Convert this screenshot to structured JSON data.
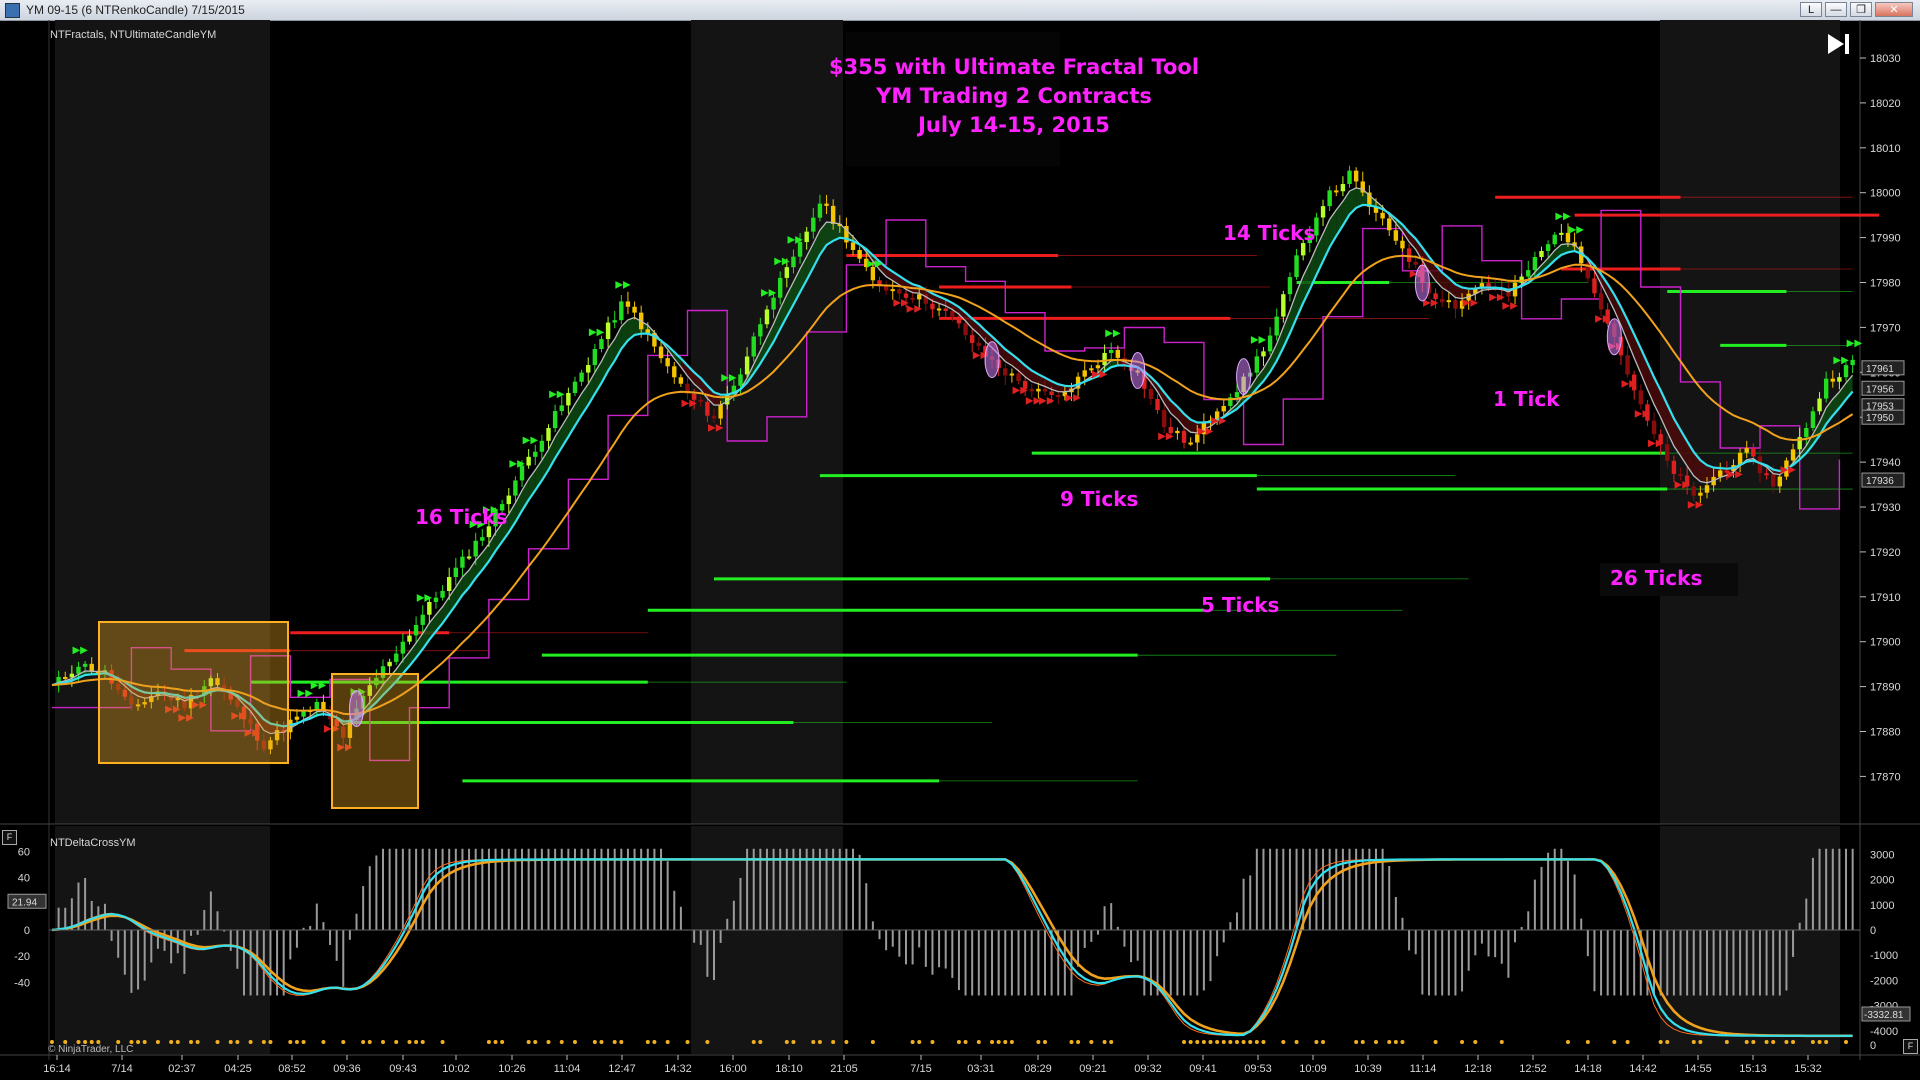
{
  "window": {
    "title": "YM 09-15 (6 NTRenkoCandle)  7/15/2015",
    "buttons": [
      "L",
      "—",
      "❐",
      "✕"
    ]
  },
  "colors": {
    "background": "#000000",
    "session_shade": "#141414",
    "up_bar": "#22dd22",
    "up_bar_light": "#b8ff2a",
    "down_bar": "#e02020",
    "down_bar_dark": "#8a0c0c",
    "neutral_bar": "#f5c400",
    "fast_ma": "#35e0ee",
    "slow_ma": "#f0a21d",
    "channel_line": "#bbbbbb",
    "support_line": "#22ee22",
    "resistance_line": "#ee1e1e",
    "fractal_line": "#cc22cc",
    "annotation": "#ff22ff",
    "highlight_box": "#e8a020"
  },
  "main_panel": {
    "indicator_label": "NTFractals, NTUltimateCandleYM",
    "headline": [
      "$355 with Ultimate Fractal Tool",
      "YM Trading 2 Contracts",
      "July 14-15, 2015"
    ],
    "annotations": [
      "16 Ticks",
      "14 Ticks",
      "9 Ticks",
      "5 Ticks",
      "1 Tick",
      "26 Ticks"
    ],
    "price_axis": [
      "18030",
      "18020",
      "18010",
      "18000",
      "17990",
      "17980",
      "17970",
      "17960",
      "17950",
      "17940",
      "17930",
      "17920",
      "17910",
      "17900",
      "17890",
      "17880",
      "17870"
    ],
    "price_markers": [
      "17961",
      "17956",
      "17953",
      "17950",
      "17936"
    ],
    "play_icon": "skip-to-end-icon"
  },
  "sub_panel": {
    "indicator_label": "NTDeltaCrossYM",
    "left_axis": [
      "60",
      "40",
      "20",
      "0",
      "-20",
      "-40"
    ],
    "left_marker": "21.94",
    "right_axis": [
      "3000",
      "2000",
      "1000",
      "0",
      "-1000",
      "-2000",
      "-3000",
      "-4000"
    ],
    "right_marker": "-3332.81",
    "panel_button": "F",
    "copyright": "© NinjaTrader, LLC",
    "zero_label": "0",
    "f_button": "F"
  },
  "time_axis": [
    "16:14",
    "7/14",
    "02:37",
    "04:25",
    "08:52",
    "09:36",
    "09:43",
    "10:02",
    "10:26",
    "11:04",
    "12:47",
    "14:32",
    "16:00",
    "18:10",
    "21:05",
    "7/15",
    "03:31",
    "08:29",
    "09:21",
    "09:32",
    "09:41",
    "09:53",
    "10:09",
    "10:39",
    "11:14",
    "12:18",
    "12:52",
    "14:18",
    "14:42",
    "14:55",
    "15:13",
    "15:32"
  ],
  "chart_data": {
    "type": "candlestick",
    "instrument": "YM 09-15",
    "bar_type": "6 NTRenkoCandle",
    "price_range": [
      17862,
      18035
    ],
    "price_path": [
      [
        0,
        17890
      ],
      [
        4,
        17895
      ],
      [
        8,
        17893
      ],
      [
        12,
        17885
      ],
      [
        16,
        17889
      ],
      [
        20,
        17886
      ],
      [
        24,
        17892
      ],
      [
        28,
        17885
      ],
      [
        32,
        17877
      ],
      [
        36,
        17882
      ],
      [
        40,
        17886
      ],
      [
        44,
        17879
      ],
      [
        48,
        17890
      ],
      [
        54,
        17902
      ],
      [
        60,
        17914
      ],
      [
        66,
        17926
      ],
      [
        72,
        17941
      ],
      [
        78,
        17955
      ],
      [
        82,
        17965
      ],
      [
        86,
        17975
      ],
      [
        88,
        17973
      ],
      [
        92,
        17963
      ],
      [
        96,
        17955
      ],
      [
        100,
        17950
      ],
      [
        104,
        17960
      ],
      [
        108,
        17975
      ],
      [
        112,
        17985
      ],
      [
        116,
        17998
      ],
      [
        120,
        17990
      ],
      [
        124,
        17980
      ],
      [
        128,
        17978
      ],
      [
        132,
        17976
      ],
      [
        136,
        17972
      ],
      [
        140,
        17965
      ],
      [
        144,
        17960
      ],
      [
        148,
        17956
      ],
      [
        152,
        17954
      ],
      [
        156,
        17960
      ],
      [
        160,
        17965
      ],
      [
        164,
        17960
      ],
      [
        168,
        17948
      ],
      [
        172,
        17944
      ],
      [
        176,
        17952
      ],
      [
        180,
        17958
      ],
      [
        184,
        17968
      ],
      [
        188,
        17985
      ],
      [
        192,
        17998
      ],
      [
        196,
        18004
      ],
      [
        200,
        17995
      ],
      [
        204,
        17988
      ],
      [
        208,
        17978
      ],
      [
        212,
        17975
      ],
      [
        216,
        17980
      ],
      [
        220,
        17977
      ],
      [
        224,
        17985
      ],
      [
        228,
        17992
      ],
      [
        232,
        17982
      ],
      [
        236,
        17968
      ],
      [
        240,
        17952
      ],
      [
        244,
        17940
      ],
      [
        248,
        17932
      ],
      [
        252,
        17938
      ],
      [
        256,
        17942
      ],
      [
        260,
        17935
      ],
      [
        264,
        17945
      ],
      [
        268,
        17958
      ],
      [
        272,
        17962
      ]
    ],
    "sub_panel": {
      "left_range": [
        -55,
        65
      ],
      "right_range": [
        -4800,
        3300
      ]
    }
  }
}
